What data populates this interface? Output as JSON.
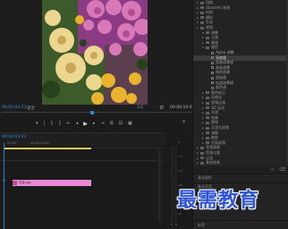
{
  "monitor": {
    "timecode_left": "00:00:04:23",
    "fit_label": "适合",
    "fraction": "1/2",
    "timecode_right": "00:00:10:00"
  },
  "timeline": {
    "timecode": "00:00:04:23",
    "ruler_marks": [
      "00:00",
      "00:00:05:00"
    ],
    "track_labels": [
      "V1",
      "A1",
      "A2"
    ],
    "clip_name": "花朵.jpg"
  },
  "meter": {
    "scale": [
      "0",
      "-12",
      "-24",
      "-36",
      "-48",
      "dB"
    ],
    "solo": [
      "S",
      "S"
    ]
  },
  "project": {
    "tree": [
      {
        "label": "扭曲",
        "indent": 0,
        "type": "folder",
        "open": false
      },
      {
        "label": "Obsolete 效果",
        "indent": 0,
        "type": "folder",
        "open": false
      },
      {
        "label": "时间",
        "indent": 0,
        "type": "folder",
        "open": false
      },
      {
        "label": "模拟",
        "indent": 0,
        "type": "folder",
        "open": false
      },
      {
        "label": "生成",
        "indent": 0,
        "type": "folder",
        "open": false
      },
      {
        "label": "视频",
        "indent": 0,
        "type": "folder",
        "open": false
      },
      {
        "label": "调整",
        "indent": 1,
        "type": "folder",
        "open": true
      },
      {
        "label": "过渡",
        "indent": 1,
        "type": "folder",
        "open": false
      },
      {
        "label": "通道",
        "indent": 1,
        "type": "folder",
        "open": false
      },
      {
        "label": "键控",
        "indent": 1,
        "type": "folder",
        "open": true
      },
      {
        "label": "Alpha 调整",
        "indent": 2,
        "type": "file",
        "open": false
      },
      {
        "label": "亮度键",
        "indent": 2,
        "type": "file",
        "open": false
      },
      {
        "label": "图像遮罩键",
        "indent": 2,
        "type": "file",
        "open": false
      },
      {
        "label": "差值遮罩",
        "indent": 2,
        "type": "file",
        "open": false
      },
      {
        "label": "移除遮罩",
        "indent": 2,
        "type": "file",
        "open": false
      },
      {
        "label": "超级键",
        "indent": 2,
        "type": "file",
        "open": false
      },
      {
        "label": "轨道遮罩键",
        "indent": 2,
        "type": "file",
        "open": false
      },
      {
        "label": "颜色键",
        "indent": 2,
        "type": "file",
        "open": false
      },
      {
        "label": "颜色校正",
        "indent": 1,
        "type": "folder",
        "open": false
      },
      {
        "label": "风格化",
        "indent": 1,
        "type": "folder",
        "open": false
      },
      {
        "label": "视频过渡",
        "indent": 1,
        "type": "folder",
        "open": false
      },
      {
        "label": "3D 运动",
        "indent": 1,
        "type": "folder",
        "open": false
      },
      {
        "label": "内滑",
        "indent": 1,
        "type": "folder",
        "open": false
      },
      {
        "label": "划像",
        "indent": 1,
        "type": "folder",
        "open": false
      },
      {
        "label": "擦除",
        "indent": 1,
        "type": "folder",
        "open": false
      },
      {
        "label": "沉浸式视频",
        "indent": 1,
        "type": "folder",
        "open": false
      },
      {
        "label": "溶解",
        "indent": 1,
        "type": "folder",
        "open": false
      },
      {
        "label": "缩放",
        "indent": 1,
        "type": "folder",
        "open": false
      },
      {
        "label": "页面剥落",
        "indent": 1,
        "type": "folder",
        "open": false
      },
      {
        "label": "音频效果",
        "indent": 0,
        "type": "folder",
        "open": false
      },
      {
        "label": "音频过渡",
        "indent": 0,
        "type": "folder",
        "open": false
      },
      {
        "label": "过滤",
        "indent": 0,
        "type": "folder",
        "open": false
      },
      {
        "label": "其他效果",
        "indent": 0,
        "type": "folder",
        "open": false
      }
    ],
    "selected_index": 11,
    "panel_titles": [
      "基本图形",
      "基本声音",
      "标签"
    ]
  },
  "watermark": "最需教育",
  "colors": {
    "timecode_blue": "#2f8fd8",
    "clip_pink": "#e98ad6",
    "work_area_yellow": "#d8c95a",
    "watermark_blue": "#2f55d6"
  }
}
